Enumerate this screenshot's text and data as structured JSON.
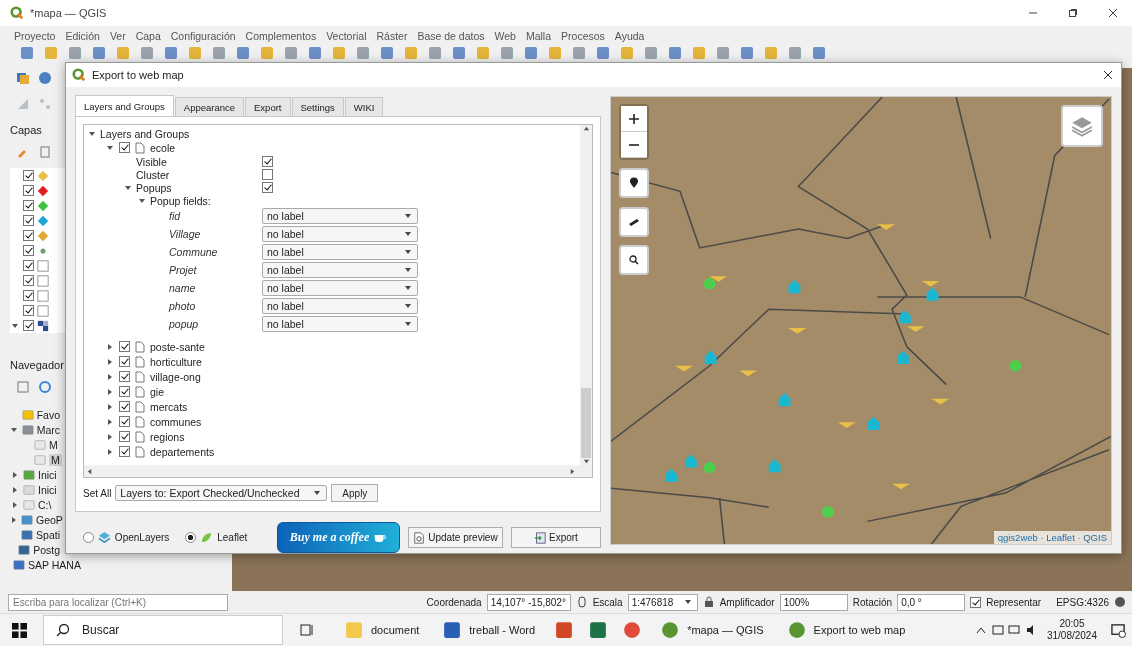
{
  "window": {
    "title": "*mapa — QGIS"
  },
  "menu": [
    "Proyecto",
    "Edición",
    "Ver",
    "Capa",
    "Configuración",
    "Complementos",
    "Vectorial",
    "Ráster",
    "Base de datos",
    "Web",
    "Malla",
    "Procesos",
    "Ayuda"
  ],
  "layers_panel": {
    "title": "Capas",
    "layers": [
      {
        "kind": "school",
        "checked": true
      },
      {
        "kind": "health",
        "checked": true
      },
      {
        "kind": "fruit",
        "checked": true
      },
      {
        "kind": "house",
        "checked": true
      },
      {
        "kind": "bulb",
        "checked": true
      },
      {
        "kind": "dot",
        "checked": true
      },
      {
        "kind": "polygon",
        "checked": true
      },
      {
        "kind": "polygon",
        "checked": true
      },
      {
        "kind": "polygon",
        "checked": true
      },
      {
        "kind": "polygon",
        "checked": true
      },
      {
        "kind": "raster",
        "checked": true,
        "expanded": true
      }
    ]
  },
  "browser_panel": {
    "title": "Navegador",
    "items": [
      {
        "label": "Favo",
        "kind": "star",
        "selected": false
      },
      {
        "label": "Marc",
        "kind": "bookmark",
        "selected": false,
        "expanded": true,
        "children": [
          {
            "label": "M",
            "kind": "folder",
            "selected": false
          },
          {
            "label": "M",
            "kind": "folder",
            "selected": true
          }
        ]
      },
      {
        "label": "Inici",
        "kind": "project",
        "selected": false,
        "expanded": false
      },
      {
        "label": "Inici",
        "kind": "home",
        "selected": false,
        "expanded": false
      },
      {
        "label": "C:\\",
        "kind": "folder",
        "selected": false,
        "expanded": false
      },
      {
        "label": "GeoP",
        "kind": "geopackage",
        "selected": false,
        "expanded": false
      },
      {
        "label": "Spati",
        "kind": "feather",
        "selected": false
      },
      {
        "label": "Postg",
        "kind": "elephant",
        "selected": false
      },
      {
        "label": "SAP HANA",
        "kind": "grid",
        "selected": false
      }
    ]
  },
  "dialog": {
    "title": "Export to web map",
    "tabs": [
      {
        "label": "Layers and Groups",
        "selected": true
      },
      {
        "label": "Appearance",
        "selected": false
      },
      {
        "label": "Export",
        "selected": false
      },
      {
        "label": "Settings",
        "selected": false
      },
      {
        "label": "WIKI",
        "selected": false
      }
    ],
    "tree": {
      "label": "Layers and Groups",
      "expanded": true,
      "layers": [
        {
          "name": "ecole",
          "checked": true,
          "expanded": true,
          "options": [
            {
              "label": "Visible",
              "checked": true
            },
            {
              "label": "Cluster",
              "checked": false
            },
            {
              "label": "Popups",
              "checked": true,
              "expanded": true
            }
          ],
          "popup_fields": {
            "label": "Popup fields:",
            "expanded": true,
            "fields": [
              {
                "name": "fid",
                "value": "no label"
              },
              {
                "name": "Village",
                "value": "no label"
              },
              {
                "name": "Commune",
                "value": "no label"
              },
              {
                "name": "Projet",
                "value": "no label"
              },
              {
                "name": "name",
                "value": "no label"
              },
              {
                "name": "photo",
                "value": "no label"
              },
              {
                "name": "popup",
                "value": "no label"
              }
            ]
          }
        },
        {
          "name": "poste-sante",
          "checked": true,
          "expanded": false
        },
        {
          "name": "horticulture",
          "checked": true,
          "expanded": false
        },
        {
          "name": "village-ong",
          "checked": true,
          "expanded": false
        },
        {
          "name": "gie",
          "checked": true,
          "expanded": false
        },
        {
          "name": "mercats",
          "checked": true,
          "expanded": false
        },
        {
          "name": "communes",
          "checked": true,
          "expanded": false
        },
        {
          "name": "regions",
          "checked": true,
          "expanded": false
        },
        {
          "name": "departements",
          "checked": true,
          "expanded": false
        }
      ]
    },
    "set_all": {
      "label": "Set All",
      "value": "Layers to: Export Checked/Unchecked",
      "button": "Apply"
    },
    "formats": [
      {
        "label": "OpenLayers",
        "kind": "openlayers",
        "selected": false
      },
      {
        "label": "Leaflet",
        "kind": "leaflet",
        "selected": true
      }
    ],
    "donate_button": "Buy me a coffee",
    "preview_button": "Update preview",
    "export_button": "Export",
    "preview": {
      "attribution": "qgis2web · Leaflet · QGIS"
    }
  },
  "status_bar": {
    "search_placeholder": "Escriba para localizar (Ctrl+K)",
    "coordinate_label": "Coordenada",
    "coordinate": "14,107° -15,802°",
    "scale_label": "Escala",
    "scale": "1:476818",
    "magnifier_label": "Amplificador",
    "magnifier": "100%",
    "rotation_label": "Rotación",
    "rotation": "0,0 °",
    "render_label": "Representar",
    "render_checked": true,
    "crs": "EPSG:4326"
  },
  "taskbar": {
    "search": "Buscar",
    "apps": [
      {
        "kind": "folder",
        "label": "document"
      },
      {
        "kind": "word",
        "label": "treball - Word"
      },
      {
        "kind": "powerpoint"
      },
      {
        "kind": "excel"
      },
      {
        "kind": "chrome"
      },
      {
        "kind": "qgis",
        "label": "*mapa — QGIS"
      },
      {
        "kind": "qgis",
        "label": "Export to web map"
      }
    ],
    "time": "20:05",
    "date": "31/08/2024"
  }
}
